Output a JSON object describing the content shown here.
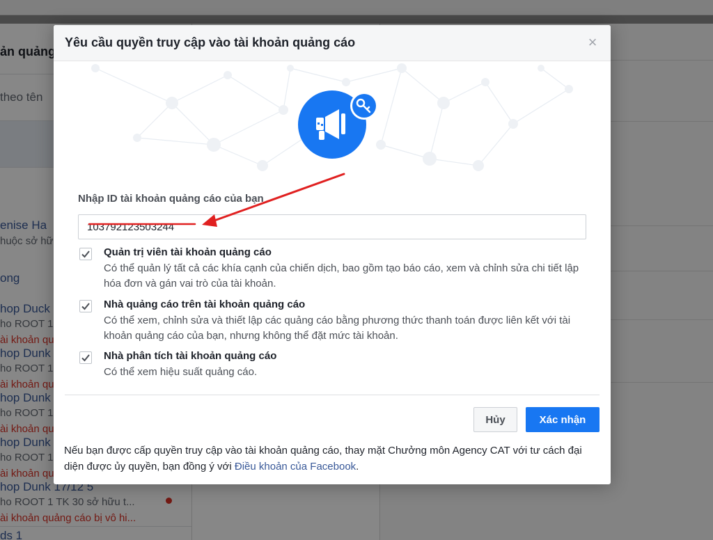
{
  "background": {
    "heading": "ản quảng",
    "search_hint": "theo tên",
    "items": [
      {
        "title": "enise Ha",
        "sub": "huộc sở hữ"
      },
      {
        "title": "ong",
        "sub": ""
      },
      {
        "title": "hop Duck",
        "sub": "ho ROOT 1",
        "warn": "ài khoản qu"
      },
      {
        "title": "hop Dunk",
        "sub": "ho ROOT 1",
        "warn": "ài khoản qu"
      },
      {
        "title": "hop Dunk",
        "sub": "ho ROOT 1",
        "warn": "ài khoản qu"
      },
      {
        "title": "hop Dunk",
        "sub": "ho ROOT 1",
        "warn": "ài khoản qu"
      },
      {
        "title": "hop Dunk 17/12 5",
        "sub": "ho ROOT 1 TK 30 sở hữu t...",
        "warn": "ài khoản quảng cáo bị vô hi..."
      },
      {
        "title": "ds 1",
        "sub": ""
      }
    ]
  },
  "dialog": {
    "title": "Yêu cầu quyền truy cập vào tài khoản quảng cáo",
    "close_label": "×",
    "field_label": "Nhập ID tài khoản quảng cáo của bạn",
    "ad_account_id": "103792123503244",
    "permissions": [
      {
        "title": "Quản trị viên tài khoản quảng cáo",
        "description": "Có thể quản lý tất cả các khía cạnh của chiến dịch, bao gồm tạo báo cáo, xem và chỉnh sửa chi tiết lập hóa đơn và gán vai trò của tài khoản.",
        "checked": true
      },
      {
        "title": "Nhà quảng cáo trên tài khoản quảng cáo",
        "description": "Có thể xem, chỉnh sửa và thiết lập các quảng cáo bằng phương thức thanh toán được liên kết với tài khoản quảng cáo của bạn, nhưng không thể đặt mức tài khoản.",
        "checked": true
      },
      {
        "title": "Nhà phân tích tài khoản quảng cáo",
        "description": "Có thể xem hiệu suất quảng cáo.",
        "checked": true
      }
    ],
    "cancel_label": "Hủy",
    "confirm_label": "Xác nhận",
    "footer_text": "Nếu bạn được cấp quyền truy cập vào tài khoản quảng cáo, thay mặt Chưởng môn Agency CAT với tư cách đại diện được ủy quyền, bạn đồng ý với ",
    "footer_link": "Điều khoản của Facebook",
    "footer_end": "."
  },
  "colors": {
    "accent": "#1877f2",
    "annotation_arrow": "#e02020"
  },
  "icons": {
    "hero": "megaphone-icon",
    "badge": "key-icon",
    "close": "close-icon",
    "check": "checkmark-icon"
  }
}
